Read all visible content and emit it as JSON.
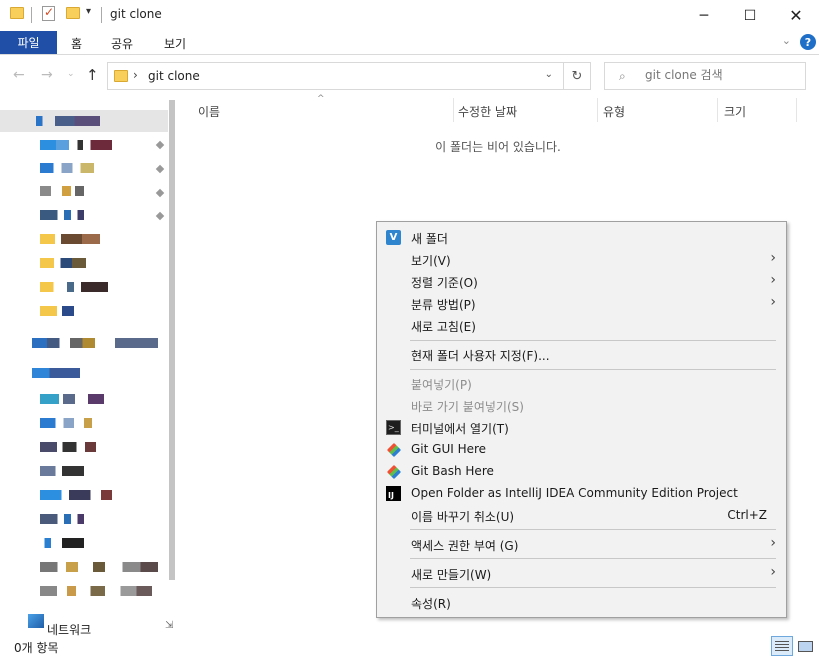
{
  "window": {
    "title": "git clone"
  },
  "ribbon": {
    "file": "파일",
    "tabs": [
      "홈",
      "공유",
      "보기"
    ]
  },
  "address": {
    "path": "git clone"
  },
  "search": {
    "placeholder": "git clone 검색"
  },
  "columns": {
    "name": "이름",
    "modified": "수정한 날짜",
    "type": "유형",
    "size": "크기"
  },
  "content": {
    "empty_message": "이 폴더는 비어 있습니다."
  },
  "navpane": {
    "network_label": "네트워크"
  },
  "status": {
    "item_count": "0개 항목"
  },
  "context_menu": {
    "new_folder": "새 폴더",
    "view": "보기(V)",
    "sort_by": "정렬 기준(O)",
    "group_by": "분류 방법(P)",
    "refresh": "새로 고침(E)",
    "customize": "현재 폴더 사용자 지정(F)...",
    "paste": "붙여넣기(P)",
    "paste_shortcut": "바로 가기 붙여넣기(S)",
    "open_terminal": "터미널에서 열기(T)",
    "git_gui": "Git GUI Here",
    "git_bash": "Git Bash Here",
    "intellij": "Open Folder as IntelliJ IDEA Community Edition Project",
    "undo_rename": "이름 바꾸기 취소(U)",
    "undo_shortcut": "Ctrl+Z",
    "give_access": "액세스 권한 부여 (G)",
    "new": "새로 만들기(W)",
    "properties": "속성(R)"
  }
}
